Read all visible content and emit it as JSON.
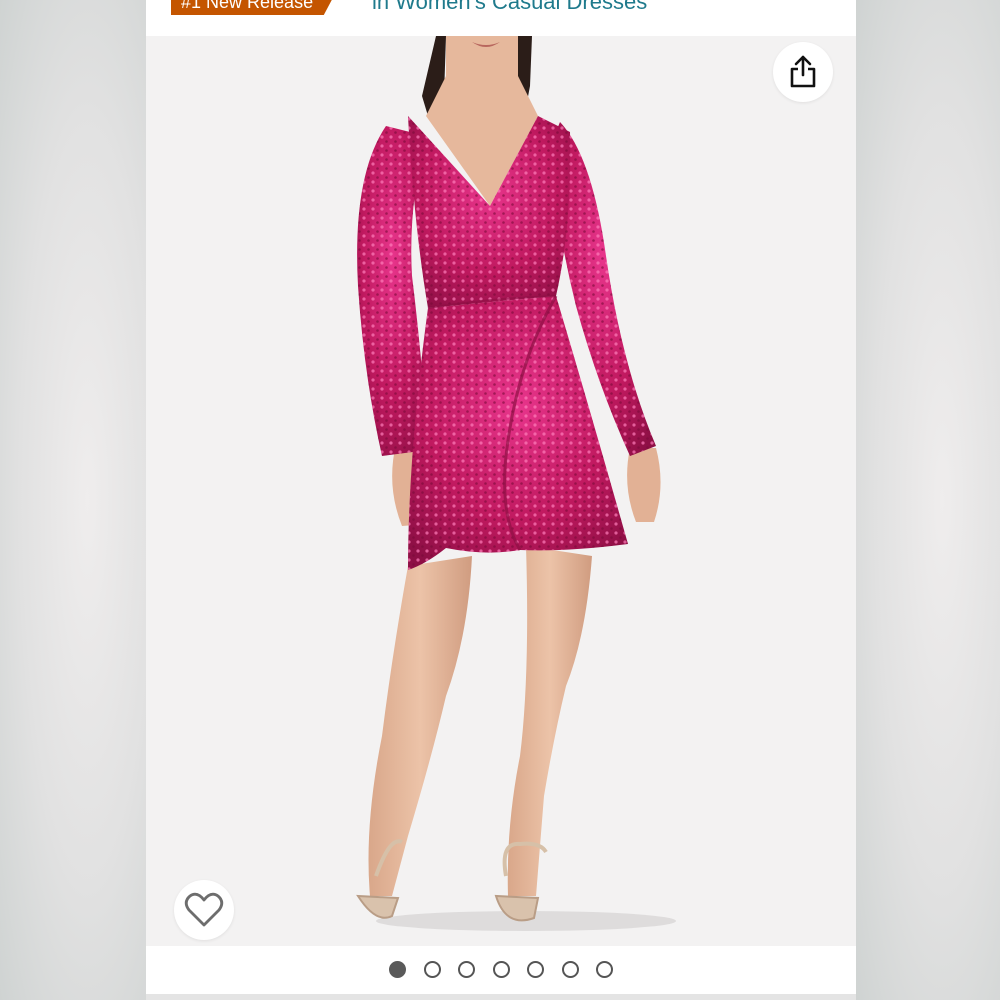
{
  "header": {
    "badge_label": "#1 New Release",
    "category_link": "in Women's Casual Dresses"
  },
  "image": {
    "alt": "Pink sequin long-sleeve wrap mini dress",
    "colors": {
      "dress": "#c0195f",
      "dress_highlight": "#ff6fb0",
      "skin": "#e6b89c",
      "background": "#f3f2f2",
      "hair": "#2b1d18"
    }
  },
  "actions": {
    "share_icon": "share-icon",
    "wishlist_icon": "heart-icon"
  },
  "carousel": {
    "total": 7,
    "active_index": 0
  },
  "colors": {
    "badge": "#c45500",
    "link": "#1f7a8c"
  }
}
